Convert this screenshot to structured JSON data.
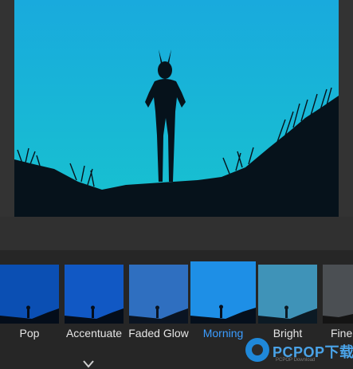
{
  "filters": [
    {
      "label": "Pop"
    },
    {
      "label": "Accentuate"
    },
    {
      "label": "Faded Glow"
    },
    {
      "label": "Morning",
      "selected": true
    },
    {
      "label": "Bright"
    },
    {
      "label": "Fine"
    }
  ],
  "colors": {
    "selected_label": "#3b9cff",
    "label": "#e6e6e6",
    "sky": "#16b7cf"
  },
  "watermark": {
    "brand": "PCPOP下载",
    "subtitle": "PCPOP Download"
  }
}
